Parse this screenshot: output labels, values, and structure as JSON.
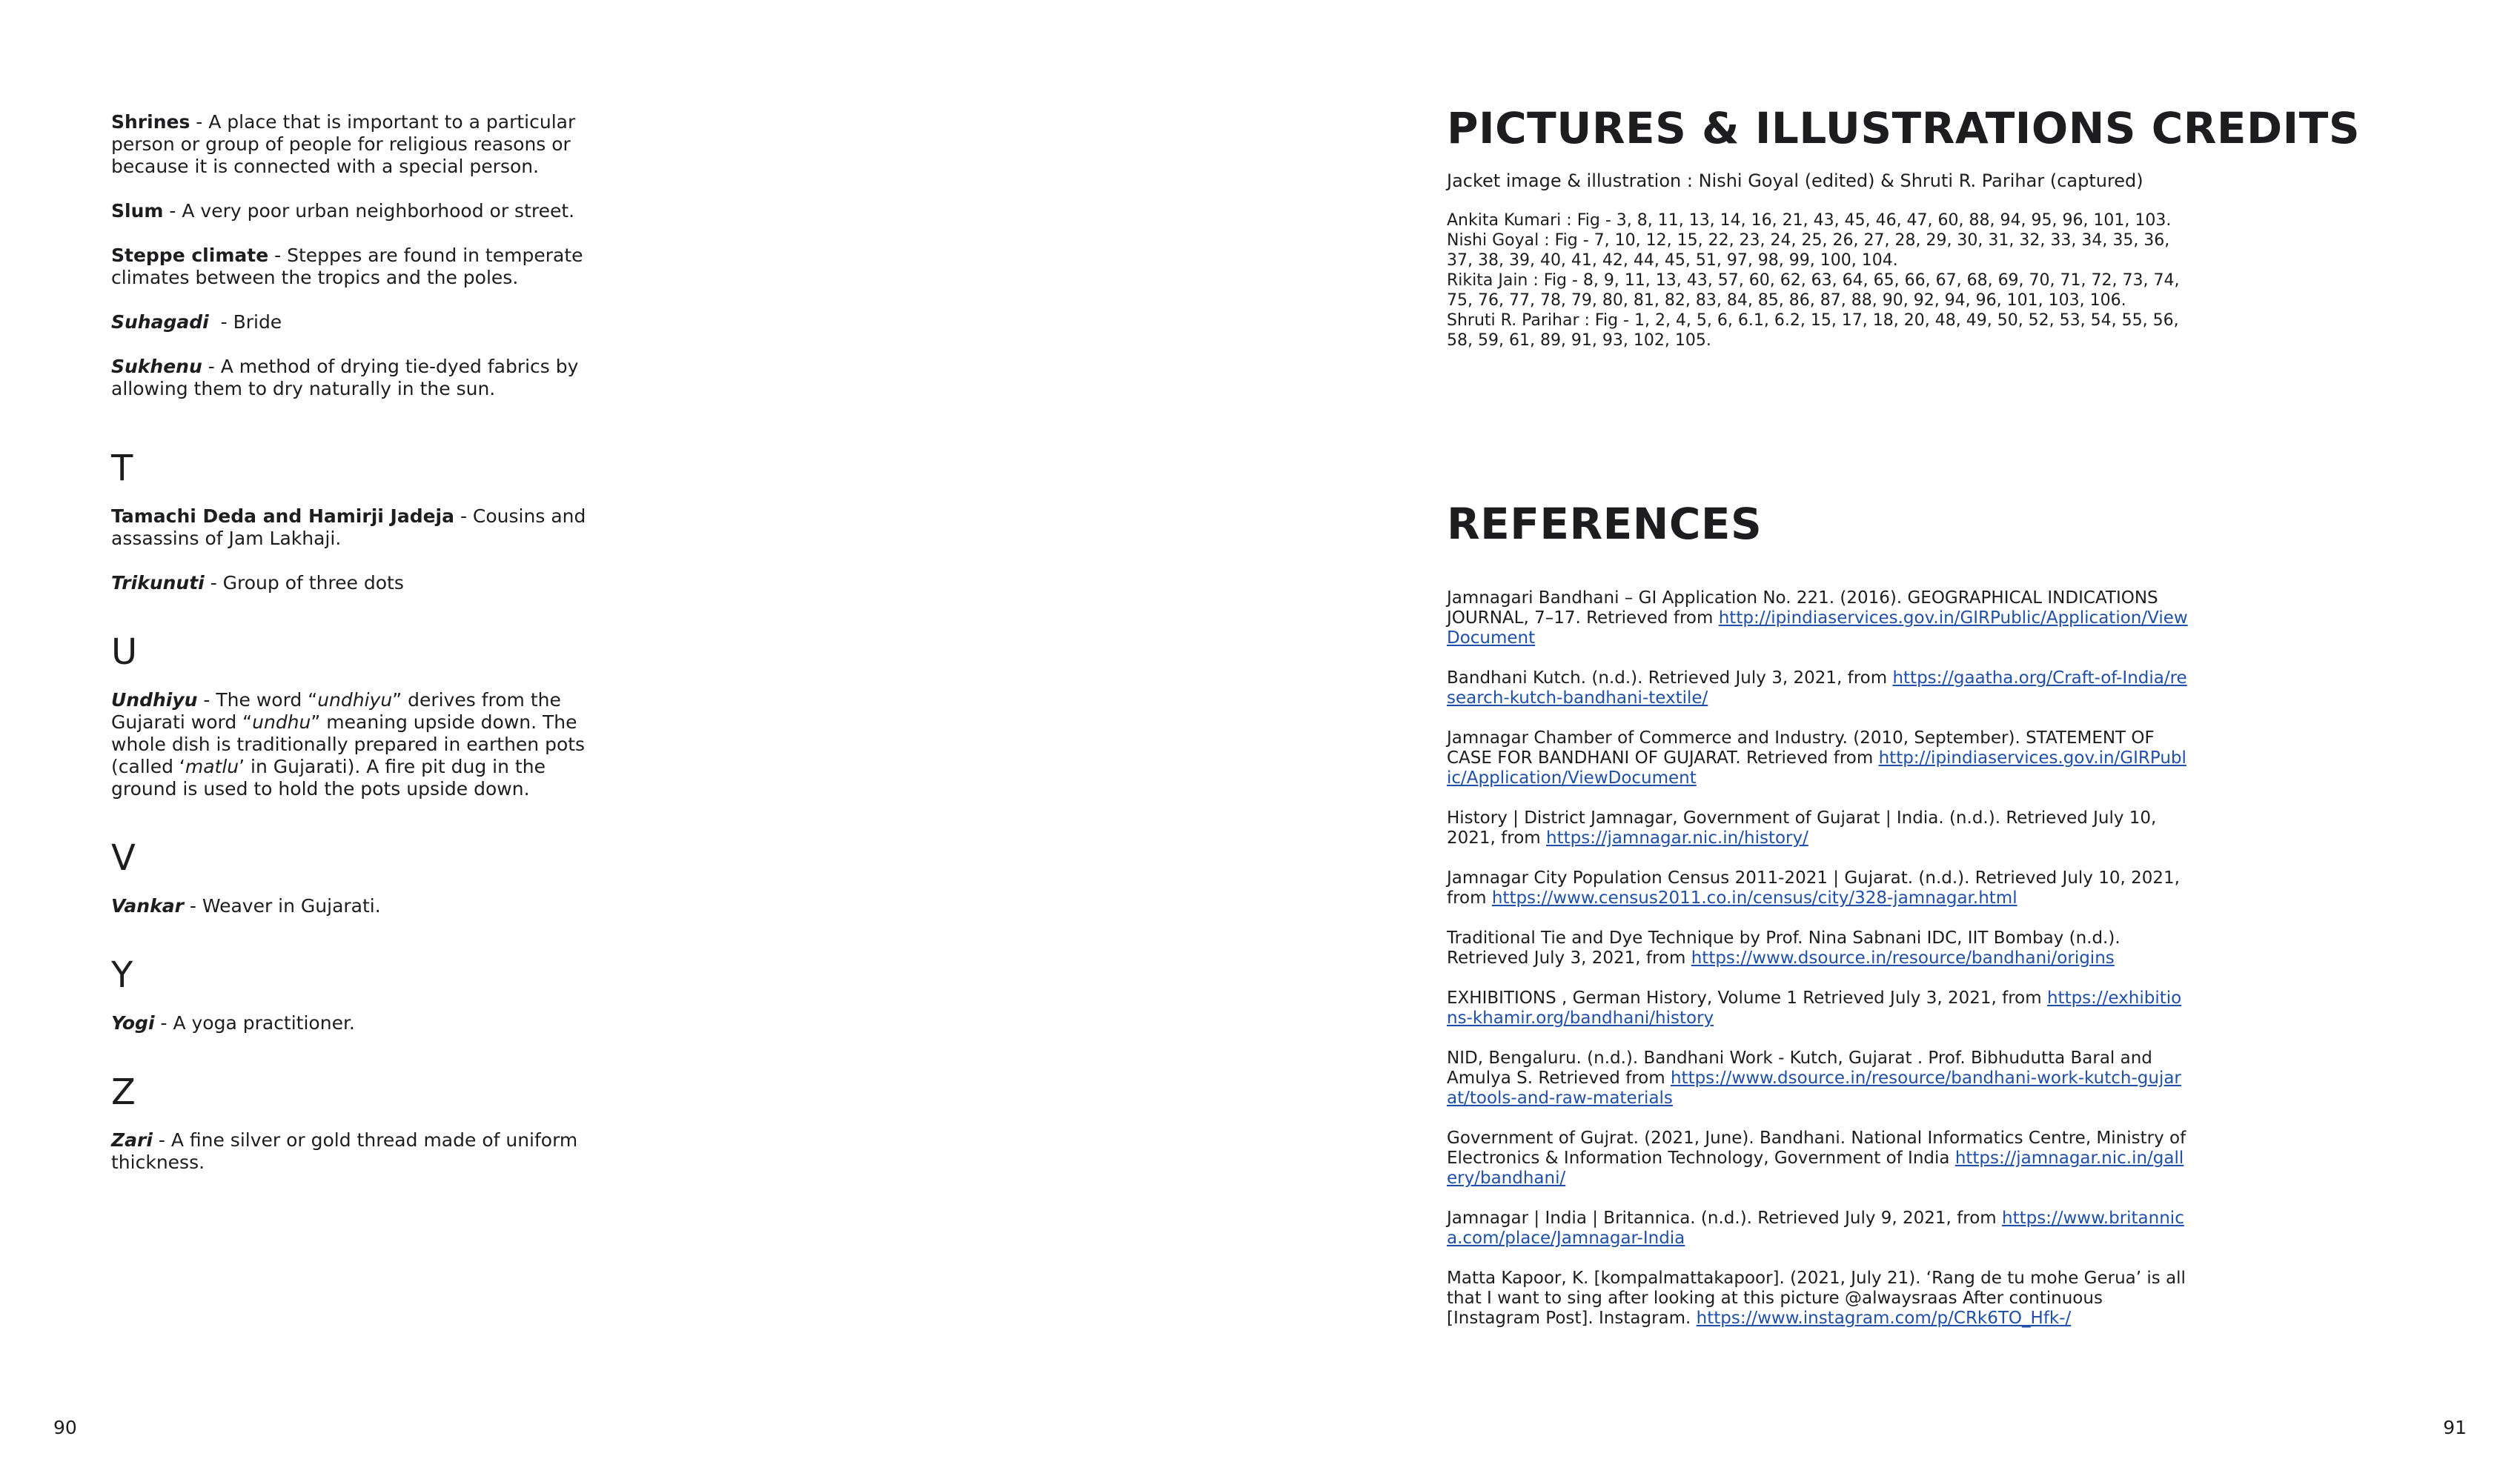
{
  "glossary": {
    "shrines": {
      "term": "Shrines",
      "def": " - A place that is important to a particular person or group of people for religious reasons or because it is connected with a special person."
    },
    "slum": {
      "term": "Slum",
      "def": " - A very poor urban neighborhood or street."
    },
    "steppe": {
      "term": "Steppe climate",
      "def": " - Steppes are found in temperate climates between the tropics and the poles."
    },
    "suhagadi": {
      "term": "Suhagadi",
      "def": "  - Bride"
    },
    "sukhenu": {
      "term": "Sukhenu",
      "def": " - A method of drying tie-dyed fabrics by allowing them to dry naturally in the sun."
    },
    "letter_t": "T",
    "tamachi": {
      "term": "Tamachi Deda and Hamirji Jadeja",
      "def": " - Cousins and assassins of Jam Lakhaji."
    },
    "trikunuti": {
      "term": "Trikunuti",
      "def": " - Group of three dots"
    },
    "letter_u": "U",
    "undhiyu": {
      "term": "Undhiyu",
      "p1": " - The word “",
      "w1": "undhiyu",
      "p2": "” derives from the Gujarati word “",
      "w2": "undhu",
      "p3": "” meaning upside down. The whole dish is traditionally prepared in earthen pots (called ‘",
      "w3": "matlu",
      "p4": "’ in Gujarati). A fire pit dug in the ground is used to hold the pots upside down."
    },
    "letter_v": "V",
    "vankar": {
      "term": "Vankar",
      "def": " - Weaver in Gujarati."
    },
    "letter_y": "Y",
    "yogi": {
      "term": "Yogi",
      "def": " - A yoga practitioner."
    },
    "letter_z": "Z",
    "zari": {
      "term": "Zari",
      "def": " - A fine silver or gold thread made of uniform thickness."
    }
  },
  "credits": {
    "heading": "PICTURES & ILLUSTRATIONS CREDITS",
    "jacket": "Jacket image & illustration : Nishi Goyal (edited) & Shruti R. Parihar (captured)",
    "lines": [
      "Ankita Kumari : Fig - 3, 8, 11, 13, 14, 16, 21, 43, 45, 46, 47, 60, 88, 94, 95, 96, 101, 103.",
      "Nishi Goyal : Fig - 7, 10, 12, 15, 22, 23, 24, 25, 26, 27, 28, 29, 30, 31, 32, 33, 34, 35, 36, 37, 38, 39, 40, 41, 42, 44, 45, 51, 97, 98, 99, 100, 104.",
      "Rikita Jain : Fig - 8, 9, 11, 13, 43, 57, 60, 62, 63, 64, 65, 66, 67, 68, 69, 70, 71, 72, 73, 74, 75, 76, 77, 78, 79, 80, 81, 82, 83, 84, 85, 86, 87, 88, 90, 92, 94, 96, 101, 103, 106.",
      "Shruti R. Parihar : Fig - 1, 2, 4, 5, 6, 6.1, 6.2, 15, 17, 18, 20, 48, 49, 50, 52, 53, 54, 55, 56, 58, 59, 61, 89, 91, 93, 102, 105."
    ]
  },
  "references": {
    "heading": "REFERENCES",
    "items": [
      {
        "text": "Jamnagari Bandhani – GI Application No. 221. (2016). GEOGRAPHICAL INDICATIONS JOURNAL, 7–17. Retrieved from ",
        "link": "http://ipindiaservices.gov.in/GIRPublic/Application/ViewDocument"
      },
      {
        "text": "Bandhani Kutch. (n.d.). Retrieved July 3, 2021, from ",
        "link": "https://gaatha.org/Craft-of-India/research-kutch-bandhani-textile/"
      },
      {
        "text": "Jamnagar Chamber of Commerce and Industry. (2010, September). STATEMENT OF CASE FOR BANDHANI OF GUJARAT. Retrieved from ",
        "link": "http://ipindiaservices.gov.in/GIRPublic/Application/ViewDocument"
      },
      {
        "text": "History | District Jamnagar, Government of Gujarat | India. (n.d.). Retrieved July 10, 2021, from ",
        "link": "https://jamnagar.nic.in/history/"
      },
      {
        "text": "Jamnagar City Population Census 2011-2021 | Gujarat. (n.d.). Retrieved July 10, 2021, from ",
        "link": "https://www.census2011.co.in/census/city/328-jamnagar.html"
      },
      {
        "text": "Traditional Tie and Dye Technique by Prof. Nina Sabnani IDC, IIT Bombay (n.d.). Retrieved July 3, 2021, from ",
        "link": "https://www.dsource.in/resource/bandhani/origins"
      },
      {
        "text": "EXHIBITIONS , German History, Volume 1 Retrieved July 3, 2021, from ",
        "link": "https://exhibitions-khamir.org/bandhani/history"
      },
      {
        "text": "NID, Bengaluru. (n.d.). Bandhani Work - Kutch, Gujarat . Prof. Bibhudutta Baral and Amulya S. Retrieved from ",
        "link": "https://www.dsource.in/resource/bandhani-work-kutch-gujarat/tools-and-raw-materials"
      },
      {
        "text": "Government of Gujrat. (2021, June). Bandhani. National Informatics Centre, Ministry of Electronics & Information Technology, Government of India ",
        "link": "https://jamnagar.nic.in/gallery/bandhani/"
      },
      {
        "text": "Jamnagar | India | Britannica. (n.d.). Retrieved July 9, 2021, from ",
        "link": "https://www.britannica.com/place/Jamnagar-India"
      },
      {
        "text": "Matta Kapoor, K. [kompalmattakapoor]. (2021, July 21). ‘Rang de tu mohe Gerua’ is all that I want to sing after looking at this picture @alwaysraas After continuous [Instagram Post]. Instagram. ",
        "link": "https://www.instagram.com/p/CRk6TO_Hfk-/"
      }
    ]
  },
  "page_numbers": {
    "left": "90",
    "right": "91"
  },
  "colors": {
    "link": "#1f4fa8",
    "text": "#1d1d1f"
  }
}
